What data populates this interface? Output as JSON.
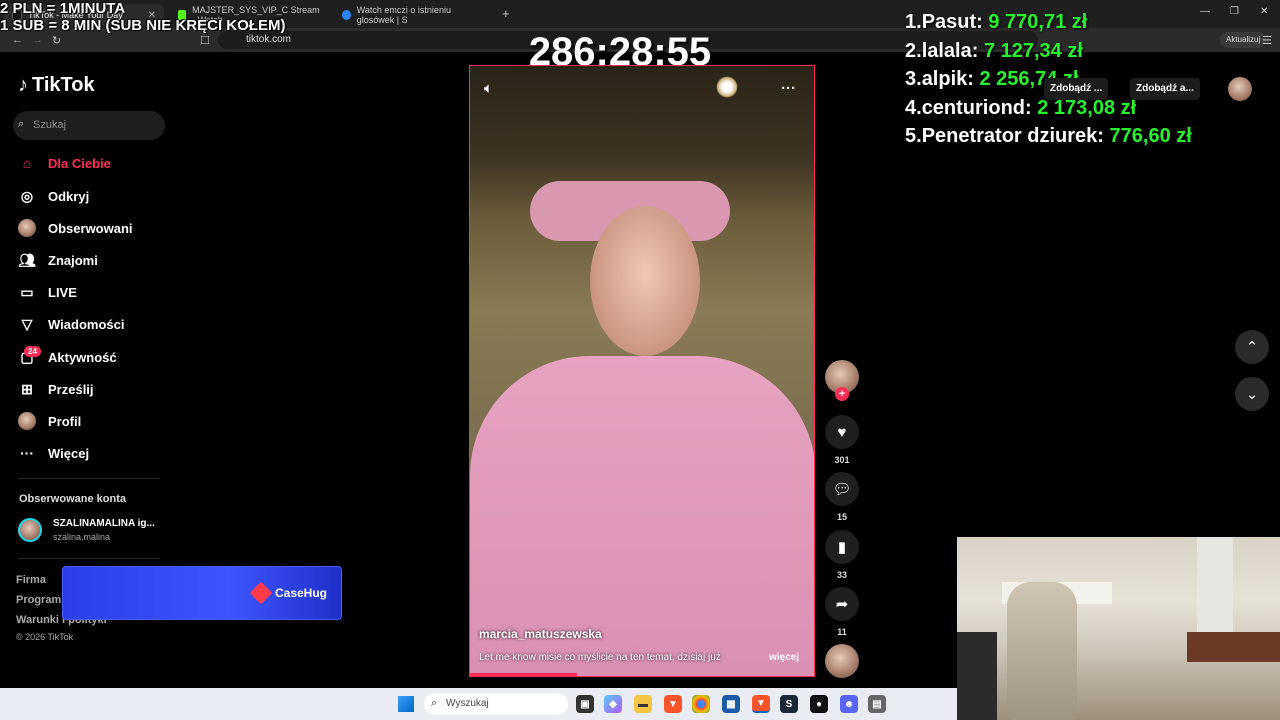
{
  "browser": {
    "tabs": [
      {
        "title": "TikTok - Make Your Day",
        "favicon_color": "#111111"
      },
      {
        "title": "MAJSTER_SYS_VIP_C Stream - Watch",
        "favicon_color": "#53fc18"
      },
      {
        "title": "Watch emczi o istnieniu glosówek | S",
        "favicon_color": "#2b84f5"
      }
    ],
    "url": "tiktok.com",
    "update_button": "Aktualizuj"
  },
  "overlay": {
    "rate_line1": "2 PLN = 1MINUTA",
    "rate_line2": "1 SUB = 8 MIN (SUB NIE KRĘCI KOŁEM)",
    "timer": "286:28:55",
    "leaderboard": [
      {
        "rank": "1.",
        "name": "Pasut:",
        "amount": "9 770,71 zł"
      },
      {
        "rank": "2.",
        "name": "lalala:",
        "amount": "7 127,34 zł"
      },
      {
        "rank": "3.",
        "name": "alpik:",
        "amount": "2 256,74 zł"
      },
      {
        "rank": "4.",
        "name": "centuriond:",
        "amount": "2 173,08 zł"
      },
      {
        "rank": "5.",
        "name": "Penetrator dziurek:",
        "amount": "776,60 zł"
      }
    ]
  },
  "tiktok": {
    "logo": "TikTok",
    "search_placeholder": "Szukaj",
    "nav": [
      {
        "label": "Dla Ciebie",
        "icon": "home-icon"
      },
      {
        "label": "Odkryj",
        "icon": "compass-icon"
      },
      {
        "label": "Obserwowani",
        "icon": "avatar"
      },
      {
        "label": "Znajomi",
        "icon": "friends-icon"
      },
      {
        "label": "LIVE",
        "icon": "live-tv-icon"
      },
      {
        "label": "Wiadomości",
        "icon": "send-icon"
      },
      {
        "label": "Aktywność",
        "icon": "inbox-icon"
      },
      {
        "label": "Prześlij",
        "icon": "upload-icon"
      },
      {
        "label": "Profil",
        "icon": "avatar"
      },
      {
        "label": "Więcej",
        "icon": "more-icon"
      }
    ],
    "activity_badge": "24",
    "followed_header": "Obserwowane konta",
    "followed_account": {
      "name": "SZALINAMALINA ig...",
      "handle": "szalina.malina"
    },
    "footer": [
      "Firma",
      "Program",
      "Warunki i polityki",
      "© 2026 TikTok"
    ],
    "header_pills": [
      "Zdobądź ...",
      "Zdobądź a..."
    ],
    "accent_color": "#fe2c55"
  },
  "promo": {
    "brand": "CaseHug"
  },
  "video": {
    "author": "marcia_matuszewska",
    "caption": "Let me know misie co myślicie na ten temat, dzisiaj już",
    "more": "więcej",
    "progress": 0.31,
    "likes": "301",
    "comments": "15",
    "saves": "33",
    "shares": "11"
  },
  "taskbar": {
    "search_placeholder": "Wyszukaj"
  }
}
